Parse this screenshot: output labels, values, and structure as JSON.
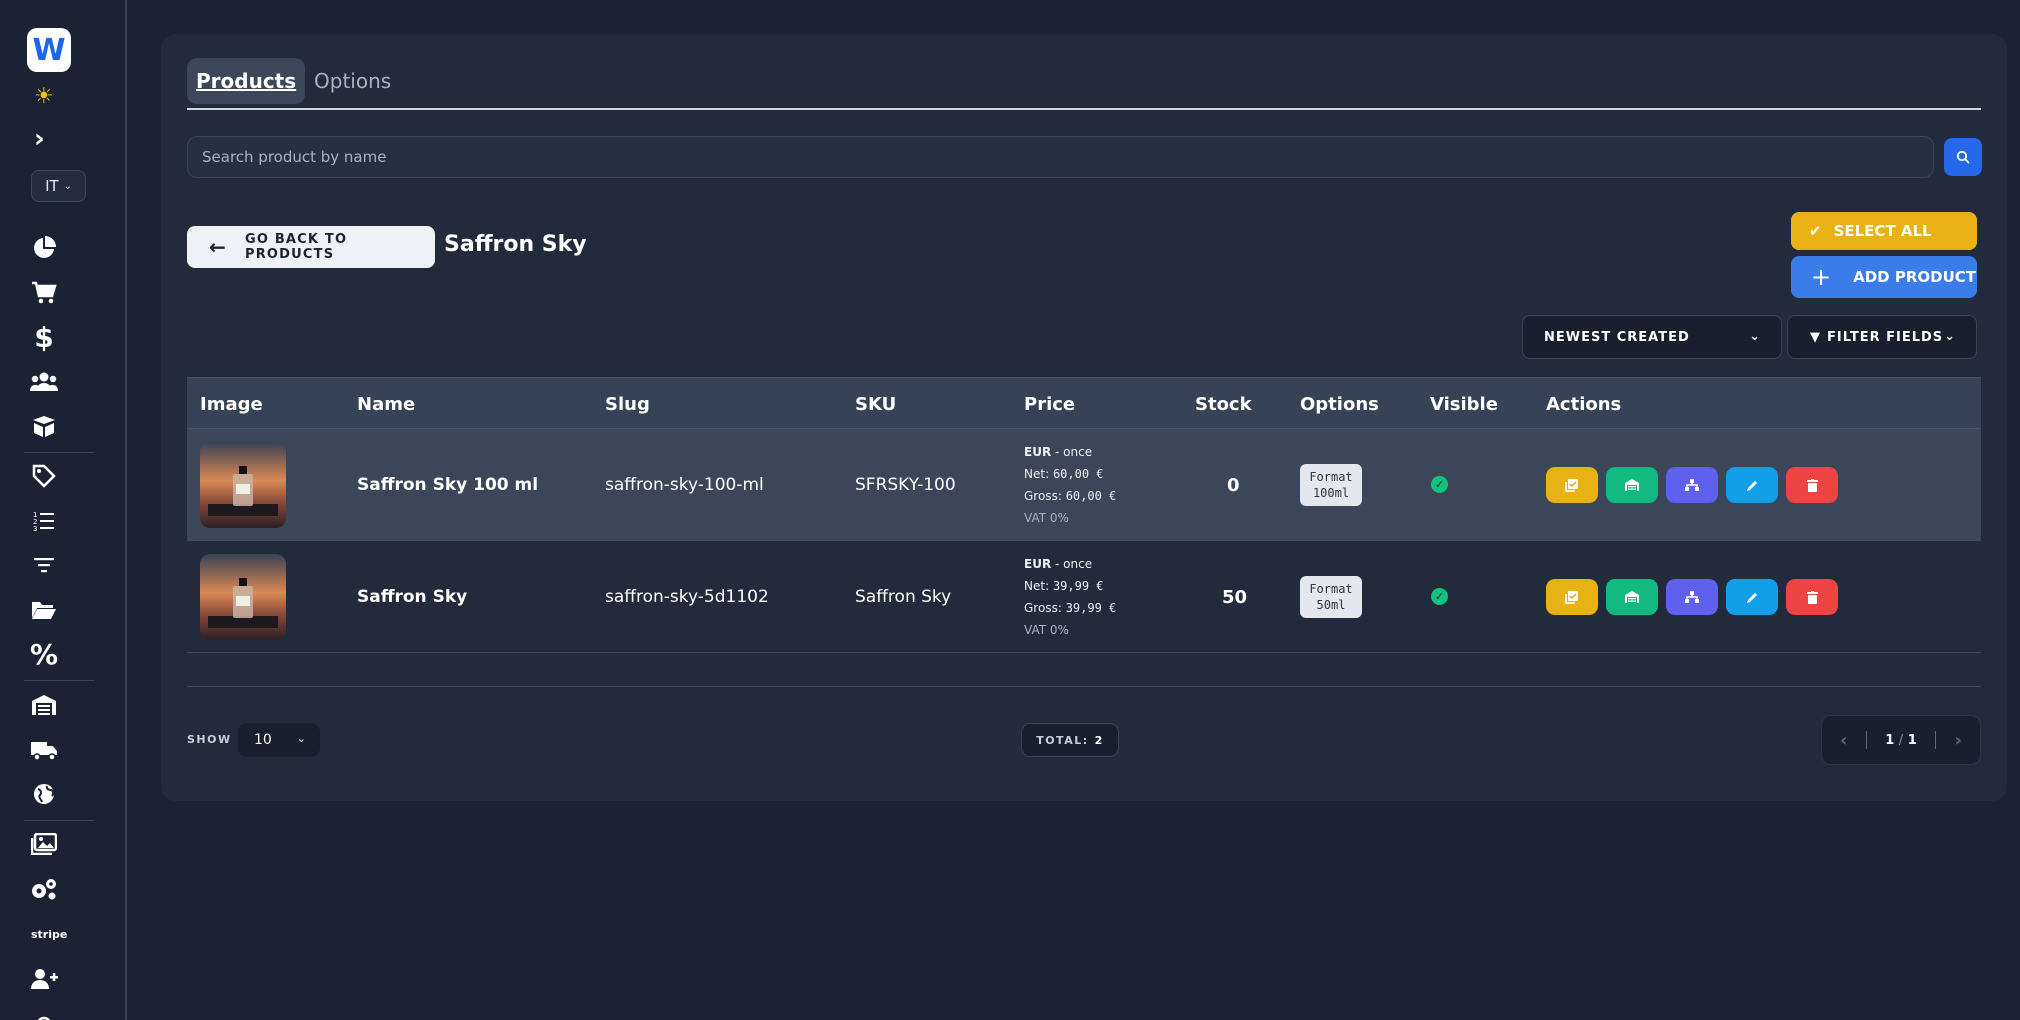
{
  "sidebar": {
    "logo_letter": "W",
    "lang": "IT",
    "stripe_label": "stripe"
  },
  "tabs": [
    {
      "label": "Products",
      "active": true
    },
    {
      "label": "Options",
      "active": false
    }
  ],
  "search": {
    "placeholder": "Search product by name"
  },
  "back_button": "GO BACK TO PRODUCTS",
  "product_title": "Saffron Sky",
  "select_all": "SELECT ALL",
  "add_product": "ADD PRODUCT",
  "sort": {
    "selected": "NEWEST CREATED"
  },
  "filter": {
    "label": "FILTER FIELDS"
  },
  "table": {
    "headers": [
      "Image",
      "Name",
      "Slug",
      "SKU",
      "Price",
      "Stock",
      "Options",
      "Visible",
      "Actions"
    ],
    "rows": [
      {
        "name": "Saffron Sky 100 ml",
        "slug": "saffron-sky-100-ml",
        "sku": "SFRSKY-100",
        "currency": "EUR",
        "frequency": "- once",
        "net_label": "Net:",
        "net": "60,00 €",
        "gross_label": "Gross:",
        "gross": "60,00 €",
        "vat": "VAT 0%",
        "stock": "0",
        "option_line1": "Format",
        "option_line2": "100ml",
        "visible": true
      },
      {
        "name": "Saffron Sky",
        "slug": "saffron-sky-5d1102",
        "sku": "Saffron Sky",
        "currency": "EUR",
        "frequency": "- once",
        "net_label": "Net:",
        "net": "39,99 €",
        "gross_label": "Gross:",
        "gross": "39,99 €",
        "vat": "VAT 0%",
        "stock": "50",
        "option_line1": "Format",
        "option_line2": "50ml",
        "visible": true
      }
    ]
  },
  "footer": {
    "show_label": "SHOW",
    "show_value": "10",
    "total_label": "TOTAL:",
    "total_value": "2",
    "page_current": "1",
    "page_sep": "/",
    "page_total": "1"
  },
  "colors": {
    "bg": "#1a2233",
    "card": "#212b3c",
    "accent_blue": "#2568ea",
    "yellow": "#e8b214",
    "green": "#12b981",
    "purple": "#5f60ee",
    "sky": "#11a0e8",
    "red": "#ef4444"
  }
}
